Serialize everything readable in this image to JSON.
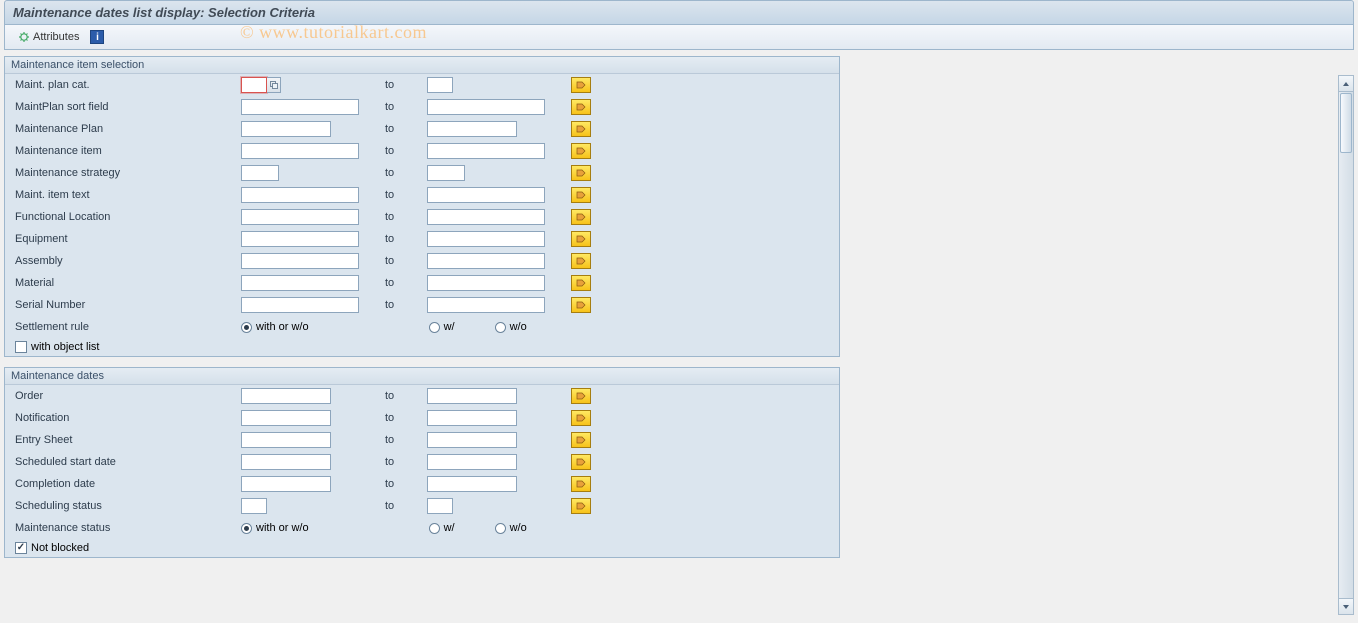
{
  "title": "Maintenance dates list display: Selection Criteria",
  "toolbar": {
    "attributes_label": "Attributes"
  },
  "watermark": "© www.tutorialkart.com",
  "labels": {
    "to": "to"
  },
  "group1": {
    "title": "Maintenance item selection",
    "rows": [
      {
        "label": "Maint. plan cat.",
        "from_w": "w-tiny",
        "to_w": "w-tiny",
        "help": true,
        "focused": true
      },
      {
        "label": "MaintPlan sort field",
        "from_w": "w-lg",
        "to_w": "w-lg"
      },
      {
        "label": "Maintenance Plan",
        "from_w": "w-md",
        "to_w": "w-md"
      },
      {
        "label": "Maintenance item",
        "from_w": "w-lg",
        "to_w": "w-lg"
      },
      {
        "label": "Maintenance strategy",
        "from_w": "w-xs",
        "to_w": "w-xs"
      },
      {
        "label": "Maint. item text",
        "from_w": "w-lg",
        "to_w": "w-lg"
      },
      {
        "label": "Functional Location",
        "from_w": "w-lg",
        "to_w": "w-lg"
      },
      {
        "label": "Equipment",
        "from_w": "w-lg",
        "to_w": "w-lg"
      },
      {
        "label": "Assembly",
        "from_w": "w-lg",
        "to_w": "w-lg"
      },
      {
        "label": "Material",
        "from_w": "w-lg",
        "to_w": "w-lg"
      },
      {
        "label": "Serial Number",
        "from_w": "w-lg",
        "to_w": "w-lg"
      }
    ],
    "settlement_rule": {
      "label": "Settlement rule",
      "options": [
        "with or w/o",
        "w/",
        "w/o"
      ],
      "selected": 0
    },
    "with_object_list": {
      "label": "with object list",
      "checked": false
    }
  },
  "group2": {
    "title": "Maintenance dates",
    "rows": [
      {
        "label": "Order",
        "from_w": "w-md",
        "to_w": "w-md"
      },
      {
        "label": "Notification",
        "from_w": "w-md",
        "to_w": "w-md"
      },
      {
        "label": "Entry Sheet",
        "from_w": "w-md",
        "to_w": "w-md"
      },
      {
        "label": "Scheduled start date",
        "from_w": "w-md",
        "to_w": "w-md"
      },
      {
        "label": "Completion date",
        "from_w": "w-md",
        "to_w": "w-md"
      },
      {
        "label": "Scheduling status",
        "from_w": "w-tiny",
        "to_w": "w-tiny"
      }
    ],
    "maintenance_status": {
      "label": "Maintenance status",
      "options": [
        "with or w/o",
        "w/",
        "w/o"
      ],
      "selected": 0
    },
    "not_blocked": {
      "label": "Not blocked",
      "checked": true
    }
  }
}
